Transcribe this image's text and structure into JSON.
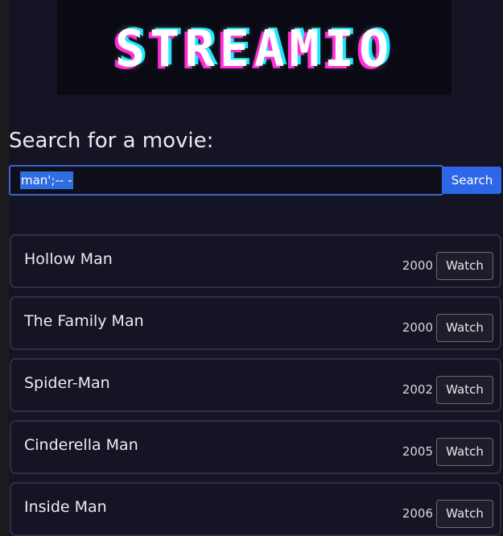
{
  "header": {
    "logo_text": "STREAMIO"
  },
  "search": {
    "heading": "Search for a movie:",
    "input_value": "man';-- -",
    "button_label": "Search"
  },
  "results": [
    {
      "title": "Hollow Man",
      "year": "2000",
      "action_label": "Watch"
    },
    {
      "title": "The Family Man",
      "year": "2000",
      "action_label": "Watch"
    },
    {
      "title": "Spider-Man",
      "year": "2002",
      "action_label": "Watch"
    },
    {
      "title": "Cinderella Man",
      "year": "2005",
      "action_label": "Watch"
    },
    {
      "title": "Inside Man",
      "year": "2006",
      "action_label": "Watch"
    }
  ],
  "colors": {
    "accent": "#2d66e6",
    "logo_magenta": "#ff2fd6",
    "logo_cyan": "#20e8ff"
  }
}
